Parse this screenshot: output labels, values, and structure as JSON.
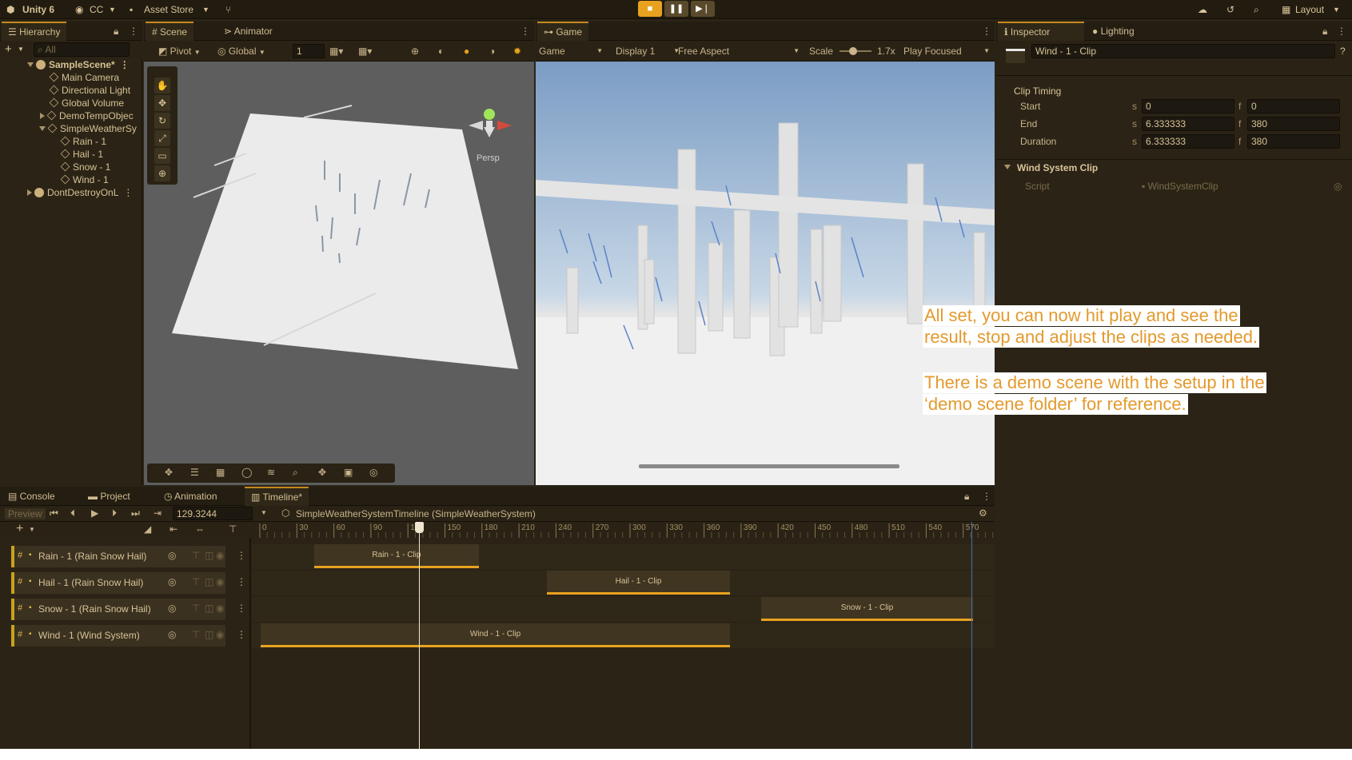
{
  "topbar": {
    "app_name": "Unity 6",
    "account": "CC",
    "asset_store": "Asset Store",
    "layout": "Layout"
  },
  "hierarchy": {
    "tab": "Hierarchy",
    "search_placeholder": "All",
    "items": [
      {
        "label": "SampleScene*"
      },
      {
        "label": "Main Camera"
      },
      {
        "label": "Directional Light"
      },
      {
        "label": "Global Volume"
      },
      {
        "label": "DemoTempObjec"
      },
      {
        "label": "SimpleWeatherSy"
      },
      {
        "label": "Rain - 1"
      },
      {
        "label": "Hail - 1"
      },
      {
        "label": "Snow - 1"
      },
      {
        "label": "Wind - 1"
      },
      {
        "label": "DontDestroyOnL"
      }
    ]
  },
  "scene": {
    "tabs": [
      "Scene",
      "Animator"
    ],
    "pivot": "Pivot",
    "global": "Global",
    "grid_value": "1",
    "persp_label": "Persp"
  },
  "game": {
    "tab": "Game",
    "mode": "Game",
    "display": "Display 1",
    "aspect": "Free Aspect",
    "scale_label": "Scale",
    "scale_value": "1.7x",
    "play_focused": "Play Focused"
  },
  "inspector": {
    "tabs": [
      "Inspector",
      "Lighting"
    ],
    "object_name": "Wind - 1 - Clip",
    "clip_timing_title": "Clip Timing",
    "rows": [
      {
        "label": "Start",
        "s": "0",
        "f": "0"
      },
      {
        "label": "End",
        "s": "6.333333",
        "f": "380"
      },
      {
        "label": "Duration",
        "s": "6.333333",
        "f": "380"
      }
    ],
    "s_unit": "s",
    "f_unit": "f",
    "component_title": "Wind System Clip",
    "script_label": "Script",
    "script_value": "WindSystemClip"
  },
  "bottom": {
    "tabs": [
      "Console",
      "Project",
      "Animation",
      "Timeline*"
    ],
    "preview": "Preview",
    "time_value": "129.3244",
    "timeline_asset": "SimpleWeatherSystemTimeline (SimpleWeatherSystem)",
    "ruler": [
      "0",
      "30",
      "60",
      "90",
      "120",
      "150",
      "180",
      "210",
      "240",
      "270",
      "300",
      "330",
      "360",
      "390",
      "420",
      "450",
      "480",
      "510",
      "540",
      "570"
    ],
    "tracks": [
      {
        "label": "Rain - 1 (Rain Snow Hail)",
        "clip": "Rain - 1 - Clip"
      },
      {
        "label": "Hail - 1 (Rain Snow Hail)",
        "clip": "Hail - 1 - Clip"
      },
      {
        "label": "Snow - 1 (Rain Snow Hail)",
        "clip": "Snow - 1 - Clip"
      },
      {
        "label": "Wind - 1 (Wind System)",
        "clip": "Wind - 1 - Clip"
      }
    ]
  },
  "overlay": {
    "line1": "All set, you can now hit play and see the",
    "line2": "result, stop and adjust the clips as needed.",
    "line3": "There is a demo scene with the setup in the",
    "line4": "‘demo scene folder’ for reference."
  },
  "colors": {
    "accent": "#e8a21f",
    "overlay_text": "#e39a2d"
  }
}
